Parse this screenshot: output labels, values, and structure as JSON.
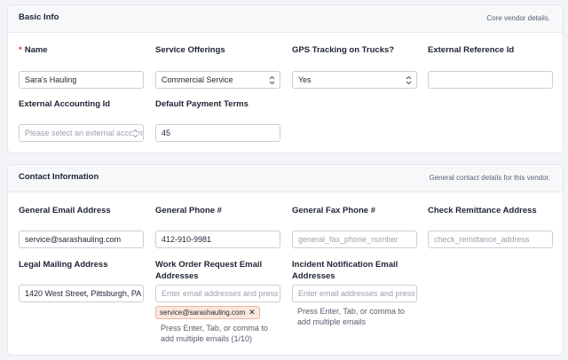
{
  "basic_info": {
    "title": "Basic Info",
    "description": "Core vendor details.",
    "name_label": "Name",
    "name_value": "Sara's Hauling",
    "service_offerings_label": "Service Offerings",
    "service_offerings_value": "Commercial Service",
    "gps_label": "GPS Tracking on Trucks?",
    "gps_value": "Yes",
    "external_ref_label": "External Reference Id",
    "external_ref_value": "",
    "external_accounting_label": "External Accounting Id",
    "external_accounting_placeholder": "Please select an external accounting id",
    "payment_terms_label": "Default Payment Terms",
    "payment_terms_value": "45"
  },
  "contact_info": {
    "title": "Contact Information",
    "description": "General contact details for this vendor.",
    "email_label": "General Email Address",
    "email_value": "service@sarashauling.com",
    "phone_label": "General Phone #",
    "phone_value": "412-910-9981",
    "fax_label": "General Fax Phone #",
    "fax_placeholder": "general_fax_phone_number",
    "remittance_label": "Check Remittance Address",
    "remittance_placeholder": "check_remittance_address",
    "mailing_label": "Legal Mailing Address",
    "mailing_value": "1420 West Street, Pittsburgh, PA",
    "work_order_label_1": "Work Order Request Email",
    "work_order_label_2": "Addresses",
    "work_order_placeholder": "Enter email addresses and press Enter",
    "work_order_tags": [
      "service@sarashauling.com"
    ],
    "work_order_hint_1": "Press Enter, Tab, or comma to",
    "work_order_hint_2": "add multiple emails (1/10)",
    "incident_label_1": "Incident Notification Email",
    "incident_label_2": "Addresses",
    "incident_placeholder": "Enter email addresses and press Enter",
    "incident_hint_1": "Press Enter, Tab, or comma to",
    "incident_hint_2": "add multiple emails"
  },
  "colors": {
    "required": "#d9393f",
    "tag_bg": "#fbe6de",
    "tag_border": "#e8b8a6"
  }
}
